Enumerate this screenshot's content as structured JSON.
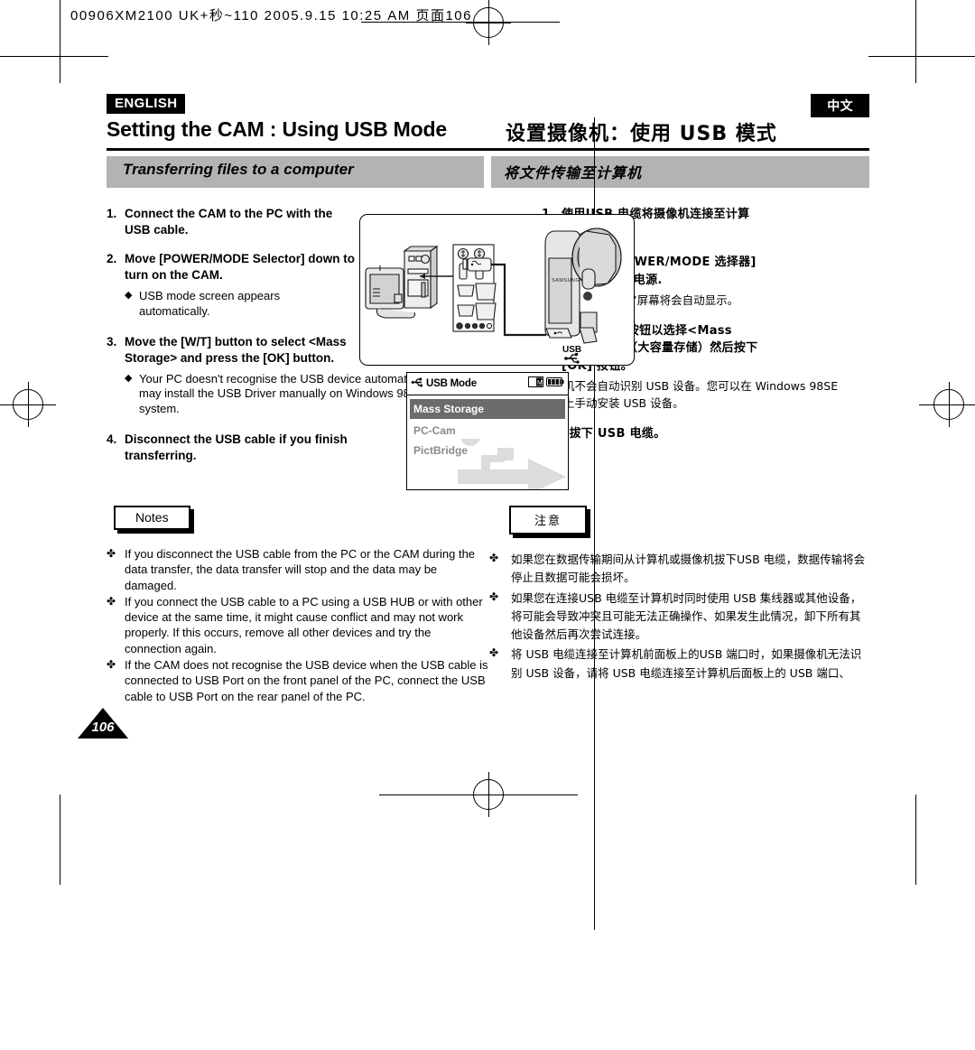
{
  "print_header": {
    "filename_line": "00906XM2100 UK+秒~110  2005.9.15 10:25 AM  页面106"
  },
  "language_tabs": {
    "english_badge": "ENGLISH",
    "chinese_badge": "中文"
  },
  "titles": {
    "english": "Setting the CAM : Using USB Mode",
    "chinese": "设置摄像机：使用 USB 模式"
  },
  "subtitles": {
    "english": "Transferring files to a computer",
    "chinese": "将文件传输至计算机"
  },
  "english_steps": [
    {
      "num": "1.",
      "text": "Connect the CAM to the PC with the USB cable.",
      "subs": []
    },
    {
      "num": "2.",
      "text": "Move [POWER/MODE Selector] down to turn on the CAM.",
      "subs": [
        "USB mode screen appears automatically."
      ]
    },
    {
      "num": "3.",
      "text": "Move the [W/T] button to select <Mass Storage> and press the [OK] button.",
      "subs": [
        "Your PC doesn't recognise the USB device automatically. You may install the USB Driver manually on Windows 98SE operating system."
      ]
    },
    {
      "num": "4.",
      "text": "Disconnect the USB cable if you finish transferring.",
      "subs": []
    }
  ],
  "chinese_steps": [
    {
      "num": "1.",
      "text": "使用USB 电缆将摄像机连接至计算机。",
      "subs": []
    },
    {
      "num": "2.",
      "text": "向下移动[POWER/MODE 选择器] 以打开摄像机电源.",
      "subs": [
        "“USB 模式”屏幕将会自动显示。"
      ]
    },
    {
      "num": "3.",
      "text": "移动[W/T] 按钮以选择<Mass Storage>（大容量存储）然后按下 [OK] 按钮。",
      "subs": [
        "您的计算机不会自动识别 USB 设备。您可以在 Windows 98SE 操作系统上手动安装 USB 设备。"
      ]
    },
    {
      "num": "4.",
      "text": "完成传输后拔下 USB 电缆。",
      "subs": []
    }
  ],
  "notes": {
    "english_label": "Notes",
    "chinese_label": "注意",
    "bullet_glyph": "✤",
    "diamond_glyph": "◆",
    "english_items": [
      "If you disconnect the USB cable from the PC or the CAM during the data transfer, the data transfer will stop and the data may be damaged.",
      "If you connect the USB cable to a PC using a USB HUB or with other device at the same time, it might cause conflict and may not work properly. If this occurs, remove all other devices and try the connection again.",
      "If the CAM does not recognise the USB device when the USB cable is connected to USB Port on the front panel of the PC, connect the USB cable to USB Port on the rear panel of the PC."
    ],
    "chinese_items": [
      "如果您在数据传输期间从计算机或摄像机拔下USB 电缆，数据传输将会停止且数据可能会损坏。",
      "如果您在连接USB 电缆至计算机时同时使用 USB 集线器或其他设备，将可能会导致冲突且可能无法正确操作、如果发生此情况，卸下所有其他设备然后再次尝试连接。",
      "将 USB 电缆连接至计算机前面板上的USB 端口时，如果摄像机无法识别 USB 设备，请将 USB 电缆连接至计算机后面板上的 USB 端口、"
    ]
  },
  "lcd_screen": {
    "title": "USB Mode",
    "usb_icon": "usb-icon",
    "card_icon": "memory-card-icon",
    "battery_icon": "battery-icon",
    "items": [
      "Mass Storage",
      "PC-Cam",
      "PictBridge"
    ],
    "selected": "Mass Storage"
  },
  "illustration": {
    "usb_label": "USB",
    "brand_label": "SAMSUNG"
  },
  "page_number": "106",
  "colors": {
    "subtitle_band": "#b3b3b3",
    "lcd_highlight": "#6b6b6b",
    "lcd_dim_text": "#8a8a8a",
    "ink": "#000000"
  }
}
